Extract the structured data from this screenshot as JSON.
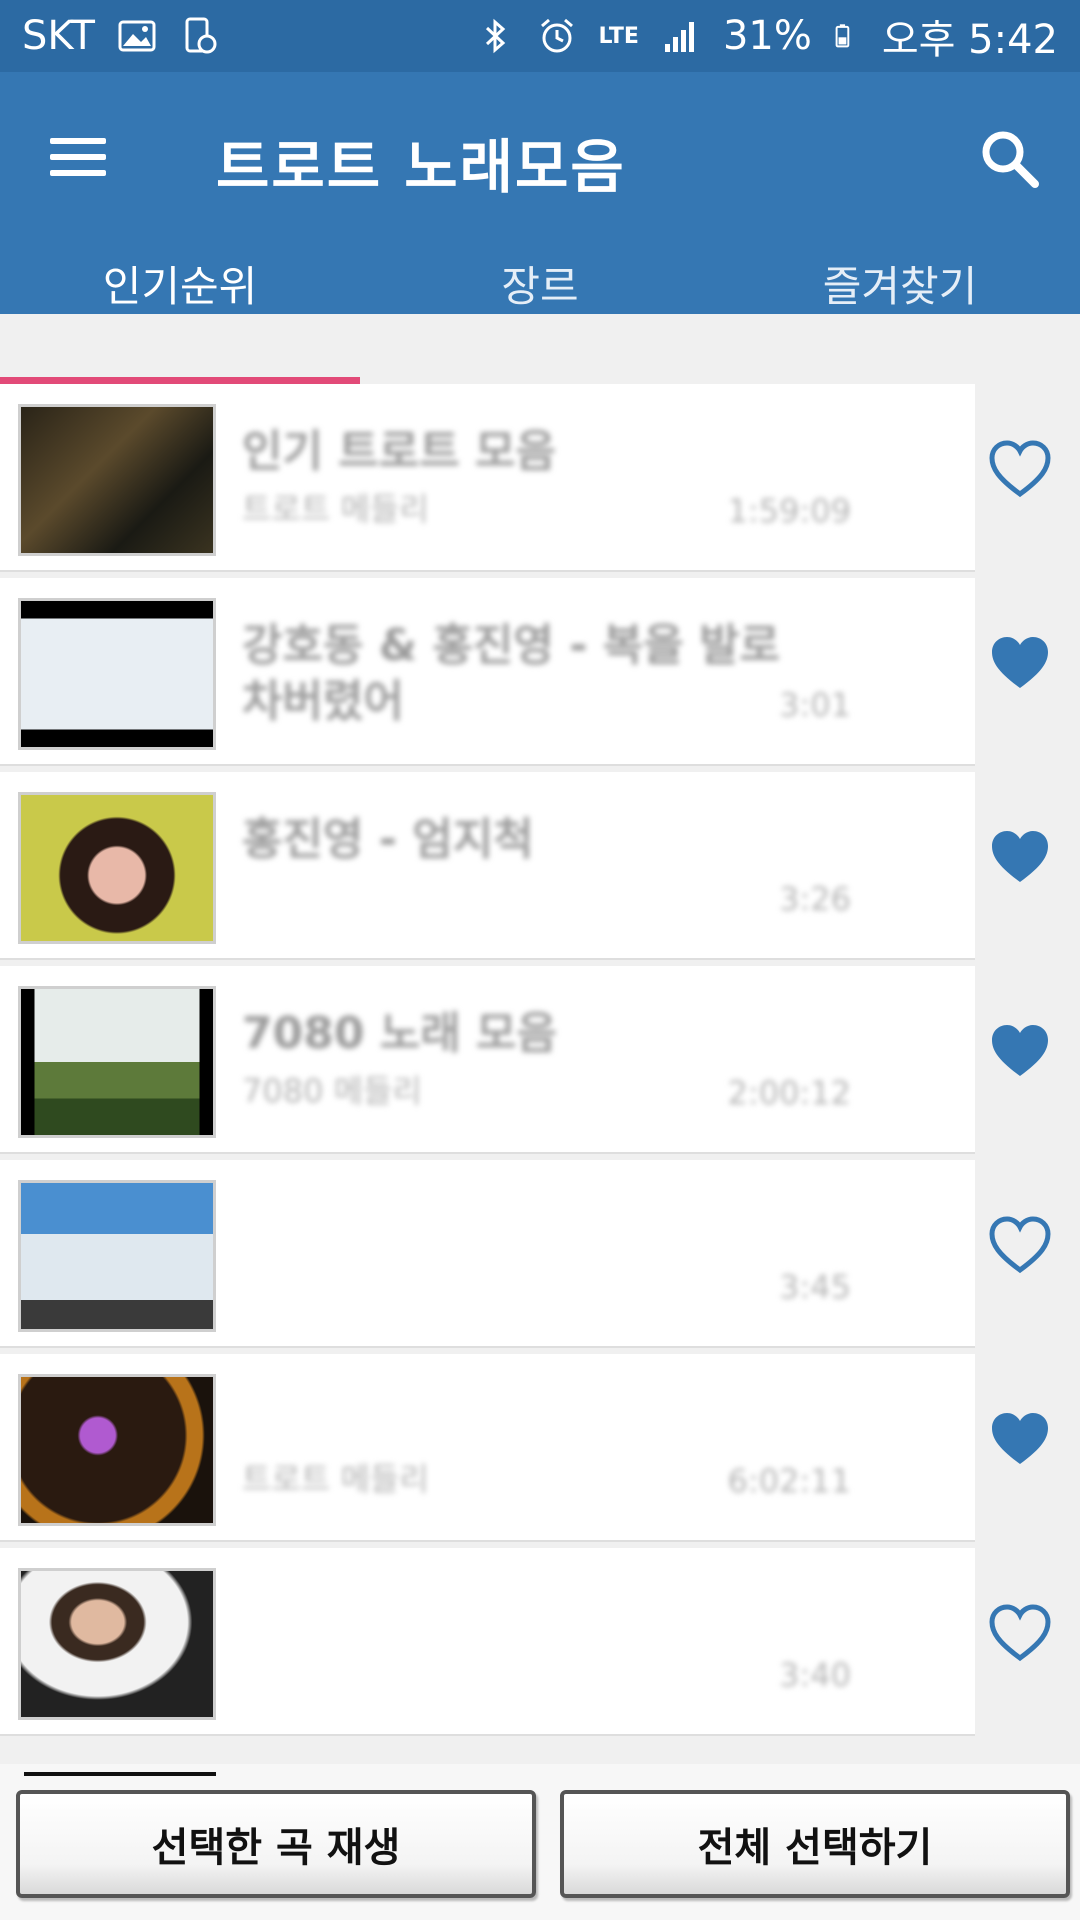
{
  "status_bar": {
    "carrier": "SKT",
    "network": "LTE",
    "battery": "31%",
    "time": "오후 5:42"
  },
  "app_bar": {
    "title": "트로트 노래모음"
  },
  "tabs": [
    {
      "label": "인기순위",
      "active": true
    },
    {
      "label": "장르",
      "active": false
    },
    {
      "label": "즐겨찾기",
      "active": false
    }
  ],
  "songs": [
    {
      "title": "인기 트로트 모음",
      "sub": "트로트 메들리",
      "duration": "1:59:09",
      "favorite": false
    },
    {
      "title": "강호동 & 홍진영 - 복을 발로 차버렸어",
      "sub": "",
      "duration": "3:01",
      "favorite": true
    },
    {
      "title": "홍진영 - 엄지척",
      "sub": "",
      "duration": "3:26",
      "favorite": true
    },
    {
      "title": "7080 노래 모음",
      "sub": "7080 메들리",
      "duration": "2:00:12",
      "favorite": true
    },
    {
      "title": "",
      "sub": "",
      "duration": "3:45",
      "favorite": false
    },
    {
      "title": "",
      "sub": "트로트 메들리",
      "duration": "6:02:11",
      "favorite": true
    },
    {
      "title": "",
      "sub": "",
      "duration": "3:40",
      "favorite": false
    }
  ],
  "buttons": {
    "play_selected": "선택한 곡 재생",
    "select_all": "전체 선택하기"
  },
  "colors": {
    "status_bar": "#2c6aa3",
    "app_bar": "#3577b3",
    "tab_indicator": "#e24a78",
    "heart": "#3577b3"
  }
}
